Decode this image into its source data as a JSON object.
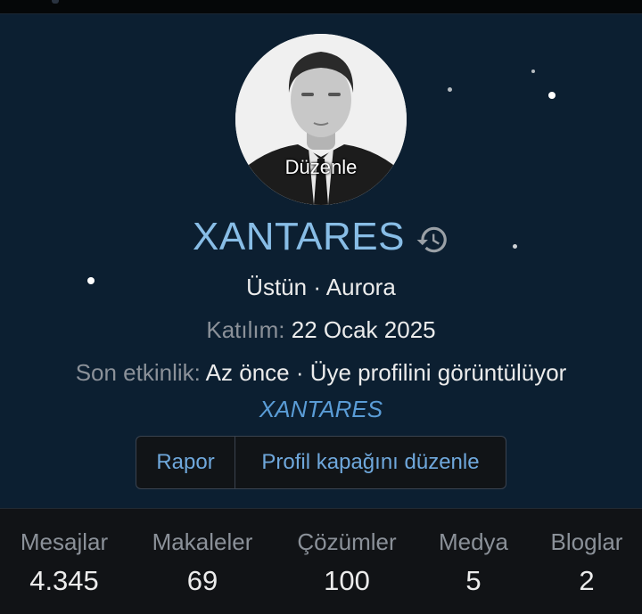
{
  "profile": {
    "avatar_edit_label": "Düzenle",
    "username": "XANTARES",
    "title_line": "Üstün · Aurora",
    "joined_label": "Katılım:",
    "joined_value": "22 Ocak 2025",
    "last_activity_label": "Son etkinlik:",
    "last_activity_value": "Az önce · Üye profilini görüntülüyor",
    "activity_link": "XANTARES"
  },
  "actions": {
    "report_label": "Rapor",
    "edit_cover_label": "Profil kapağını düzenle"
  },
  "stats": [
    {
      "label": "Mesajlar",
      "value": "4.345"
    },
    {
      "label": "Makaleler",
      "value": "69"
    },
    {
      "label": "Çözümler",
      "value": "100"
    },
    {
      "label": "Medya",
      "value": "5"
    },
    {
      "label": "Bloglar",
      "value": "2"
    }
  ],
  "icons": {
    "history": "history-icon"
  },
  "colors": {
    "username": "#88bde6",
    "link": "#5a9cd6",
    "background": "#0c1f31"
  }
}
